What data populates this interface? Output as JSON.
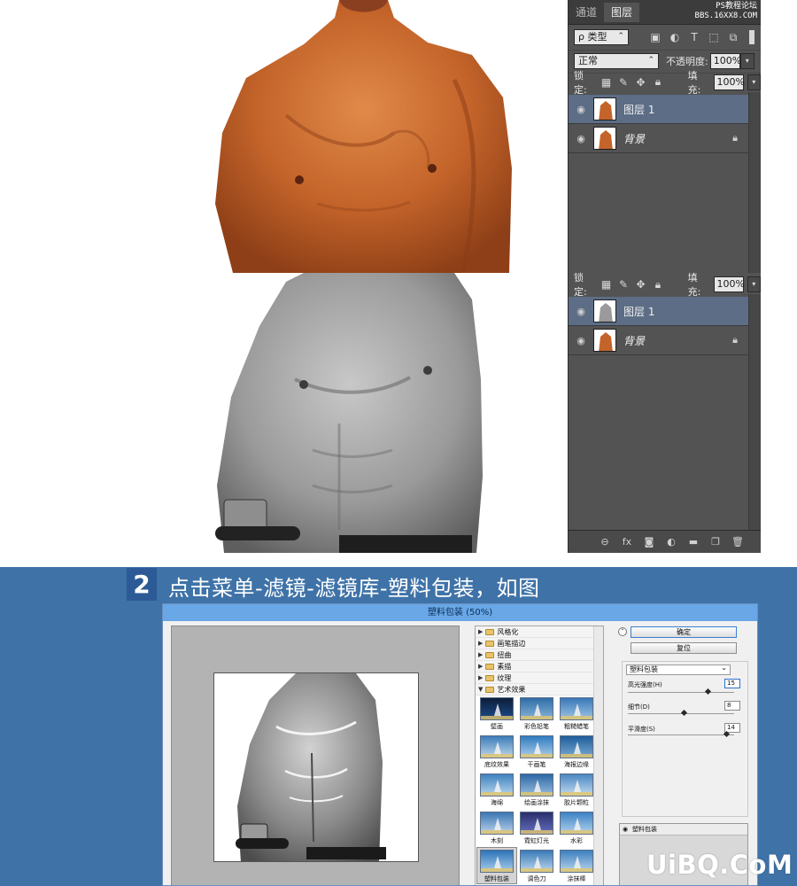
{
  "colors": {
    "page_background": "#3f73a8",
    "ps_panel": "#535353",
    "ps_selected_layer": "#5d6d86",
    "step_badge": "#2c5a96",
    "window_title": "#69a7e6"
  },
  "watermark": {
    "line1": "PS教程论坛",
    "line2": "BBS.16XX8.COM"
  },
  "ps_panel_top": {
    "tabs": [
      {
        "label": "通道"
      },
      {
        "label": "图层"
      }
    ],
    "kind_filter": "ρ 类型",
    "blend_mode": "正常",
    "opacity_label": "不透明度:",
    "opacity_value": "100%",
    "lock_label": "锁定:",
    "fill_label": "填充:",
    "fill_value": "100%",
    "layers": [
      {
        "name": "图层 1",
        "selected": true
      },
      {
        "name": "背景",
        "selected": false,
        "locked": true
      }
    ]
  },
  "ps_panel_bottom": {
    "lock_label": "锁定:",
    "fill_label": "填充:",
    "fill_value": "100%",
    "layers": [
      {
        "name": "图层 1",
        "selected": true
      },
      {
        "name": "背景",
        "selected": false,
        "locked": true
      }
    ]
  },
  "step": {
    "number": "2",
    "instruction": "点击菜单-滤镜-滤镜库-塑料包装，如图"
  },
  "filter_gallery": {
    "title": "塑料包装 (50%)",
    "categories": [
      {
        "label": "风格化",
        "expanded": false
      },
      {
        "label": "画笔描边",
        "expanded": false
      },
      {
        "label": "扭曲",
        "expanded": false
      },
      {
        "label": "素描",
        "expanded": false
      },
      {
        "label": "纹理",
        "expanded": false
      },
      {
        "label": "艺术效果",
        "expanded": true
      }
    ],
    "filters": [
      {
        "label": "壁画"
      },
      {
        "label": "彩色铅笔"
      },
      {
        "label": "粗糙蜡笔"
      },
      {
        "label": "底纹效果"
      },
      {
        "label": "干画笔"
      },
      {
        "label": "海报边缘"
      },
      {
        "label": "海绵"
      },
      {
        "label": "绘画涂抹"
      },
      {
        "label": "胶片颗粒"
      },
      {
        "label": "木刻"
      },
      {
        "label": "霓虹灯光"
      },
      {
        "label": "水彩"
      },
      {
        "label": "塑料包装",
        "selected": true
      },
      {
        "label": "调色刀"
      },
      {
        "label": "涂抹棒"
      }
    ],
    "ok_label": "确定",
    "reset_label": "复位",
    "filter_select": "塑料包装",
    "options": [
      {
        "label": "高光强度(H)",
        "value": "15",
        "level": 0.75
      },
      {
        "label": "细节(D)",
        "value": "8",
        "level": 0.53
      },
      {
        "label": "平滑度(S)",
        "value": "14",
        "level": 0.93
      }
    ],
    "effect_layer_label": "塑料包装"
  },
  "brand": "UiBQ.CoM"
}
